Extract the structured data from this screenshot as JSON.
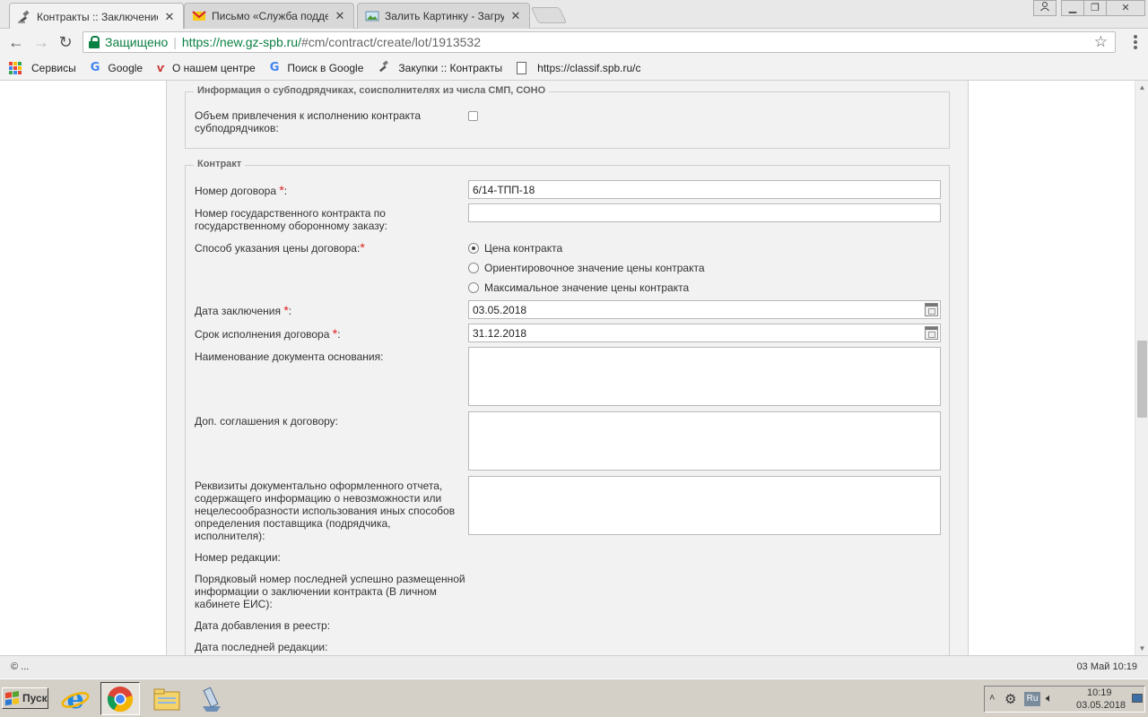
{
  "tabs": [
    {
      "title": "Контракты :: Заключение",
      "active": true
    },
    {
      "title": "Письмо «Служба поддерж",
      "active": false
    },
    {
      "title": "Залить Картинку - Загруз",
      "active": false
    }
  ],
  "toolbar": {
    "secure_label": "Защищено",
    "url_host": "https://new.gz-spb.ru/",
    "url_path": "#cm/contract/create/lot/1913532"
  },
  "bookmarks": [
    {
      "label": "Сервисы",
      "icon": "apps-grid-icon"
    },
    {
      "label": "Google",
      "icon": "google-icon"
    },
    {
      "label": "О нашем центре",
      "icon": "center-logo-icon"
    },
    {
      "label": "Поиск в Google",
      "icon": "google-icon"
    },
    {
      "label": "Закупки :: Контракты",
      "icon": "gavel-icon"
    },
    {
      "label": "https://classif.spb.ru/c",
      "icon": "document-icon"
    }
  ],
  "form": {
    "subcontractors": {
      "legend": "Информация о субподрядчиках, соисполнителях из числа СМП, СОНО",
      "volume_label": "Объем привлечения к исполнению контракта субподрядчиков:"
    },
    "contract": {
      "legend": "Контракт",
      "contract_number_label": "Номер договора",
      "contract_number_value": "6/14-ТПП-18",
      "gov_contract_label": "Номер государственного контракта по государственному оборонному заказу:",
      "gov_contract_value": "",
      "price_method_label": "Способ указания цены договора:",
      "price_options": [
        "Цена контракта",
        "Ориентировочное значение цены контракта",
        "Максимальное значение цены контракта"
      ],
      "conclusion_date_label": "Дата заключения",
      "conclusion_date_value": "03.05.2018",
      "execution_term_label": "Срок исполнения договора",
      "execution_term_value": "31.12.2018",
      "basis_doc_label": "Наименование документа основания:",
      "additional_agreements_label": "Доп. соглашения к договору:",
      "report_details_label": "Реквизиты документально оформленного отчета, содержащего информацию о невозможности или нецелесообразности использования иных способов определения поставщика (подрядчика, исполнителя):",
      "revision_number_label": "Номер редакции:",
      "serial_number_label": "Порядковый номер последней успешно размещенной информации о заключении контракта (В личном кабинете ЕИС):",
      "registry_date_label": "Дата добавления в реестр:",
      "last_edit_date_label": "Дата последней редакции:"
    }
  },
  "statusbar": {
    "left": "© ...",
    "right": "03 Май 10:19"
  },
  "taskbar": {
    "start_label": "Пуск",
    "lang": "Ru",
    "time": "10:19",
    "date": "03.05.2018"
  },
  "colors": {
    "secure_green": "#0b8043",
    "required_red": "#e02020",
    "form_bg": "#f2f2f2"
  }
}
